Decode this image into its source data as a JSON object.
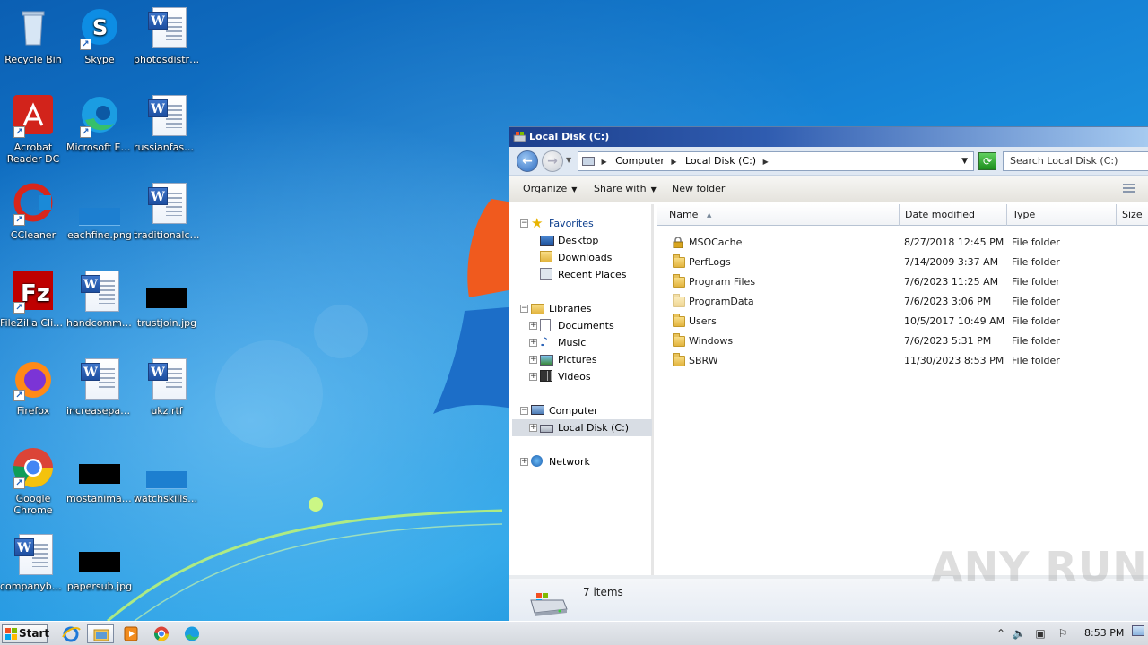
{
  "desktop": {
    "icons": [
      {
        "label": "Recycle Bin"
      },
      {
        "label": "Skype"
      },
      {
        "label": "photosdistri..."
      },
      {
        "label": "Acrobat Reader DC"
      },
      {
        "label": "Microsoft Edge"
      },
      {
        "label": "russianfashi..."
      },
      {
        "label": "CCleaner"
      },
      {
        "label": "eachfine.png"
      },
      {
        "label": "traditionalco..."
      },
      {
        "label": "FileZilla Client"
      },
      {
        "label": "handcommu..."
      },
      {
        "label": "trustjoin.jpg"
      },
      {
        "label": "Firefox"
      },
      {
        "label": "increasepar..."
      },
      {
        "label": "ukz.rtf"
      },
      {
        "label": "Google Chrome"
      },
      {
        "label": "mostanimals..."
      },
      {
        "label": "watchskills...."
      },
      {
        "label": "companyba..."
      },
      {
        "label": "papersub.jpg"
      }
    ]
  },
  "explorer": {
    "title": "Local Disk (C:)",
    "address": {
      "crumbs": [
        "Computer",
        "Local Disk (C:)"
      ]
    },
    "search_placeholder": "Search Local Disk (C:)",
    "toolbar": {
      "organize": "Organize",
      "share_with": "Share with",
      "new_folder": "New folder"
    },
    "nav": {
      "favorites": "Favorites",
      "desktop": "Desktop",
      "downloads": "Downloads",
      "recent_places": "Recent Places",
      "libraries": "Libraries",
      "documents": "Documents",
      "music": "Music",
      "pictures": "Pictures",
      "videos": "Videos",
      "computer": "Computer",
      "local_disk": "Local Disk (C:)",
      "network": "Network"
    },
    "columns": {
      "name": "Name",
      "date_modified": "Date modified",
      "type": "Type",
      "size": "Size"
    },
    "rows": [
      {
        "name": "MSOCache",
        "date": "8/27/2018 12:45 PM",
        "type": "File folder"
      },
      {
        "name": "PerfLogs",
        "date": "7/14/2009 3:37 AM",
        "type": "File folder"
      },
      {
        "name": "Program Files",
        "date": "7/6/2023 11:25 AM",
        "type": "File folder"
      },
      {
        "name": "ProgramData",
        "date": "7/6/2023 3:06 PM",
        "type": "File folder"
      },
      {
        "name": "Users",
        "date": "10/5/2017 10:49 AM",
        "type": "File folder"
      },
      {
        "name": "Windows",
        "date": "7/6/2023 5:31 PM",
        "type": "File folder"
      },
      {
        "name": "SBRW",
        "date": "11/30/2023 8:53 PM",
        "type": "File folder"
      }
    ],
    "status": {
      "item_count": "7 items"
    }
  },
  "watermark": "ANY RUN",
  "taskbar": {
    "start_label": "Start",
    "clock": "8:53 PM"
  }
}
